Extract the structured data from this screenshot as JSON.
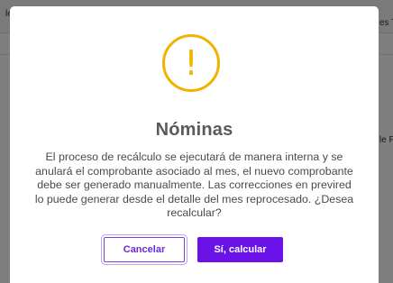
{
  "background": {
    "tab_left": "les",
    "tab_right": "es T",
    "side_text": "le F"
  },
  "modal": {
    "icon": "exclamation-icon",
    "icon_glyph": "!",
    "title": "Nóminas",
    "message": "El proceso de recálculo se ejecutará de manera interna y se anulará el comprobante asociado al mes, el nuevo comprobante debe ser generado manualmente. Las correcciones en previred lo puede generar desde el detalle del mes reprocesado. ¿Desea recalcular?",
    "cancel_label": "Cancelar",
    "confirm_label": "Sí, calcular"
  },
  "colors": {
    "warning": "#f0b400",
    "primary": "#6a11e8",
    "overlay": "rgba(0,0,0,0.5)"
  }
}
